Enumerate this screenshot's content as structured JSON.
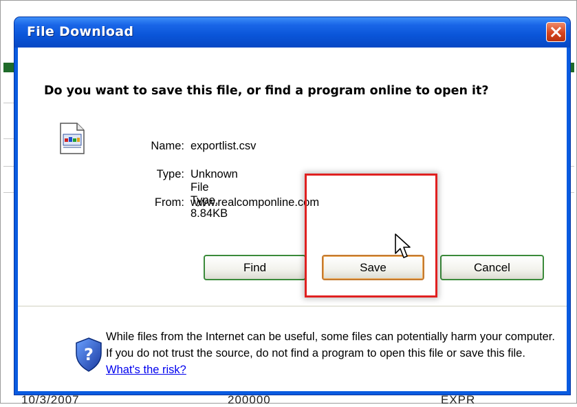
{
  "dialog": {
    "title": "File Download",
    "question": "Do you want to save this file, or find a program online to open it?",
    "file": {
      "name_label": "Name:",
      "name_value": "exportlist.csv",
      "type_label": "Type:",
      "type_value": "Unknown File Type, 8.84KB",
      "from_label": "From:",
      "from_value": "www.realcomponline.com"
    },
    "buttons": {
      "find": "Find",
      "save": "Save",
      "cancel": "Cancel"
    },
    "warning": {
      "text": "While files from the Internet can be useful, some files can potentially harm your computer. If you do not trust the source, do not find a program to open this file or save this file.",
      "link": "What's the risk?"
    }
  },
  "background": {
    "row_date": "10/3/2007",
    "row_number": "200000",
    "row_code": "EXPR"
  },
  "colors": {
    "title_bar": "#0a55d8",
    "close_button": "#d6441d",
    "button_border": "#3a8a3a",
    "highlight_box": "#e02020",
    "link": "#0000ee"
  },
  "icons": [
    "close-x-icon",
    "file-csv-icon",
    "shield-question-icon",
    "mouse-pointer-icon"
  ]
}
